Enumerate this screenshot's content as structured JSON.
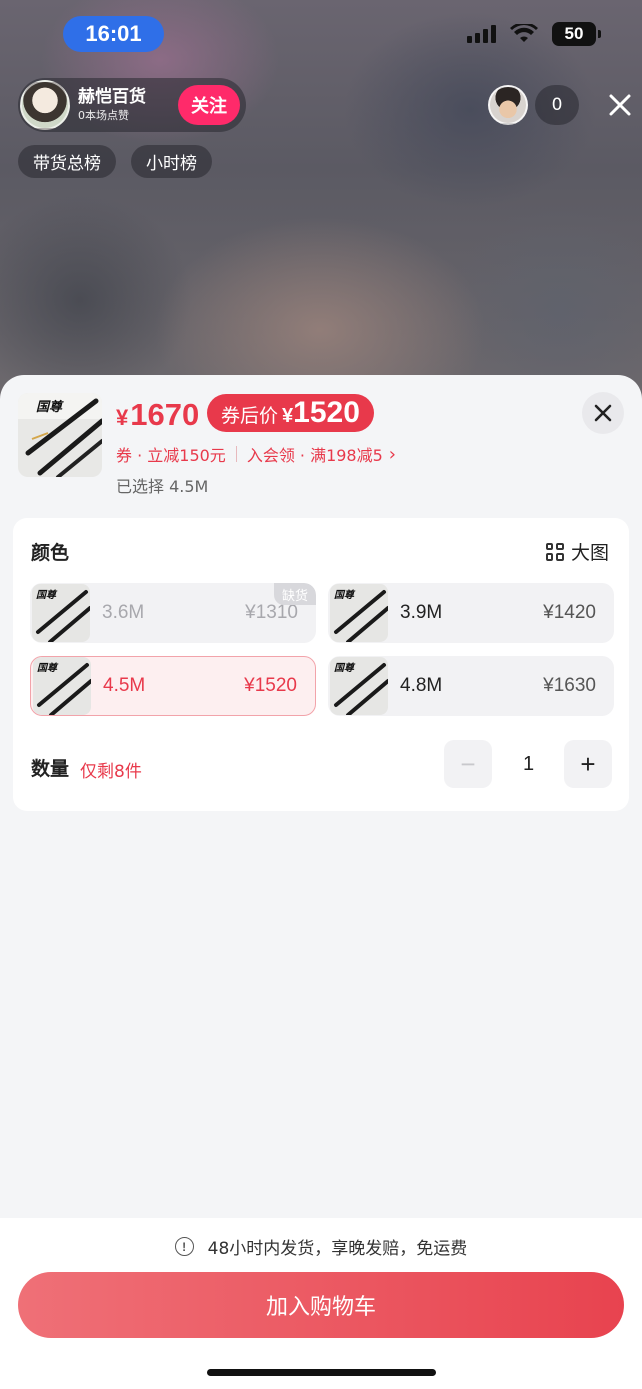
{
  "status_bar": {
    "time": "16:01",
    "battery": "50"
  },
  "live": {
    "anchor_name": "赫恺百货",
    "anchor_likes": "0本场点赞",
    "follow_label": "关注",
    "rank_tags": [
      "带货总榜",
      "小时榜"
    ],
    "viewer_count": "0"
  },
  "product": {
    "thumb_brand": "国尊",
    "price_symbol": "¥",
    "price": "1670",
    "coupon_label": "券后价",
    "coupon_symbol": "¥",
    "coupon_price": "1520",
    "promo_coupon": "券 · 立减150元",
    "promo_member": "入会领 · 满198减5",
    "selected": "已选择 4.5M"
  },
  "options": {
    "title": "颜色",
    "big_image_label": "大图",
    "items": [
      {
        "label": "3.6M",
        "price": "¥1310",
        "tag": "缺货",
        "state": "disabled"
      },
      {
        "label": "3.9M",
        "price": "¥1420",
        "state": "normal"
      },
      {
        "label": "4.5M",
        "price": "¥1520",
        "state": "selected"
      },
      {
        "label": "4.8M",
        "price": "¥1630",
        "state": "normal"
      }
    ]
  },
  "quantity": {
    "label": "数量",
    "remaining": "仅剩8件",
    "value": "1",
    "minus": "−",
    "plus": "+"
  },
  "footer": {
    "shipping_note": "48小时内发货，享晚发赔，免运费",
    "info_icon": "!",
    "cart_button": "加入购物车"
  },
  "colors": {
    "accent": "#e8394b",
    "follow": "#ff2a6a",
    "status_time_bg": "#2f6fe8"
  }
}
